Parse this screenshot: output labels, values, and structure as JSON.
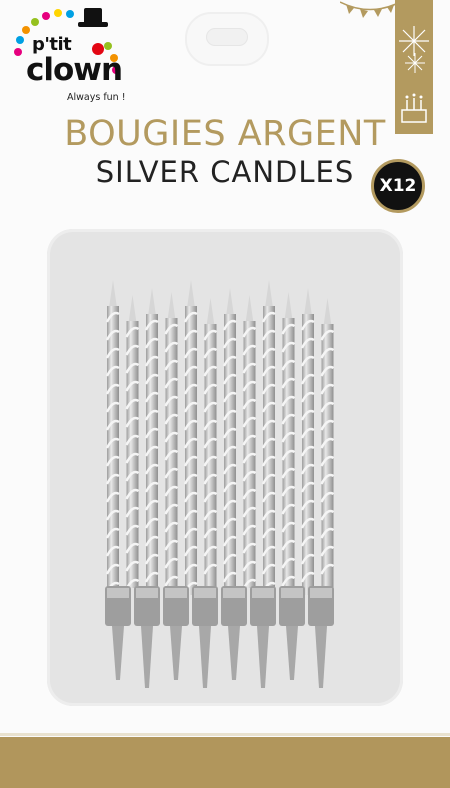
{
  "brand": {
    "name_small": "p'tit",
    "name_big": "clown",
    "tagline": "Always fun !"
  },
  "product": {
    "title_fr": "BOUGIES ARGENT",
    "title_en": "SILVER CANDLES",
    "quantity": "X12"
  },
  "colors": {
    "gold": "#b39a5f",
    "dark": "#111111",
    "blister": "#e4e4e4",
    "candle": "#c2c2c2"
  },
  "icons": {
    "logo_hat": "top-hat-icon",
    "logo_nose": "clown-nose-icon",
    "fireworks": "fireworks-icon",
    "bunting": "bunting-icon",
    "cake": "birthday-cake-icon"
  },
  "candle_count": 12
}
